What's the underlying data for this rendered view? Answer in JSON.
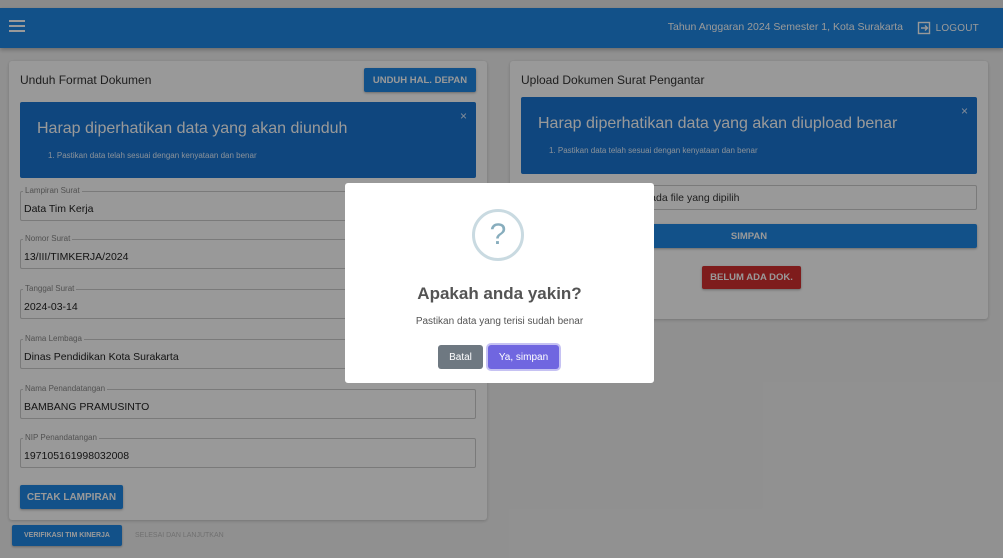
{
  "appbar": {
    "title": "Tahun Anggaran 2024 Semester 1, Kota Surakarta",
    "logout_label": "LOGOUT"
  },
  "left_card": {
    "title": "Unduh Format Dokumen",
    "download_button": "UNDUH HAL. DEPAN",
    "alert": {
      "title": "Harap diperhatikan data yang akan diunduh",
      "item": "1. Pastikan data telah sesuai dengan kenyataan dan benar",
      "close": "×"
    },
    "fields": [
      {
        "label": "Lampiran Surat",
        "value": "Data Tim Kerja"
      },
      {
        "label": "Nomor Surat",
        "value": "13/III/TIMKERJA/2024"
      },
      {
        "label": "Tanggal Surat",
        "value": "2024-03-14"
      },
      {
        "label": "Nama Lembaga",
        "value": "Dinas Pendidikan Kota Surakarta"
      },
      {
        "label": "Nama Penandatangan",
        "value": "BAMBANG PRAMUSINTO"
      },
      {
        "label": "NIP Penandatangan",
        "value": "197105161998032008"
      }
    ],
    "print_button": "CETAK LAMPIRAN"
  },
  "right_card": {
    "title": "Upload Dokumen Surat Pengantar",
    "alert": {
      "title": "Harap diperhatikan data yang akan diupload benar",
      "item": "1. Pastikan data telah sesuai dengan kenyataan dan benar",
      "close": "×"
    },
    "file_status": "k ada file yang dipilih",
    "save_button": "SIMPAN",
    "no_doc_button": "BELUM ADA DOK."
  },
  "bottom": {
    "verify_button": "VERIFIKASI TIM KINERJA",
    "next_link": "SELESAI DAN LANJUTKAN"
  },
  "modal": {
    "icon": "?",
    "title": "Apakah anda yakin?",
    "text": "Pastikan data yang terisi sudah benar",
    "cancel": "Batal",
    "confirm": "Ya, simpan"
  },
  "colors": {
    "primary": "#1e88e5",
    "alert": "#1976d2",
    "danger": "#d32f2f",
    "confirm": "#7066e0"
  }
}
